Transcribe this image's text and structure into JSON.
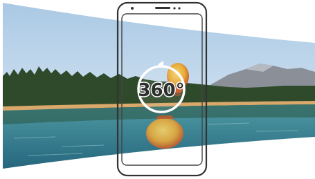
{
  "badge": {
    "text": "360°",
    "text_color": "#2e2e2e",
    "ring_color": "#ffffff"
  },
  "colors": {
    "sky_top": "#a9c8e4",
    "sky_bottom": "#e6f0f7",
    "forest": "#2f4a2a",
    "mountain": "#8a8f98",
    "shore": "#d9a86a",
    "water_top": "#4f9aa3",
    "water_bottom": "#1f5e78",
    "balloon": "#e8b63a",
    "phone_outline": "#333333"
  },
  "icons": [
    "rotate-arrow-icon",
    "hot-air-balloon-icon",
    "phone-speaker-icon",
    "phone-camera-icon"
  ]
}
